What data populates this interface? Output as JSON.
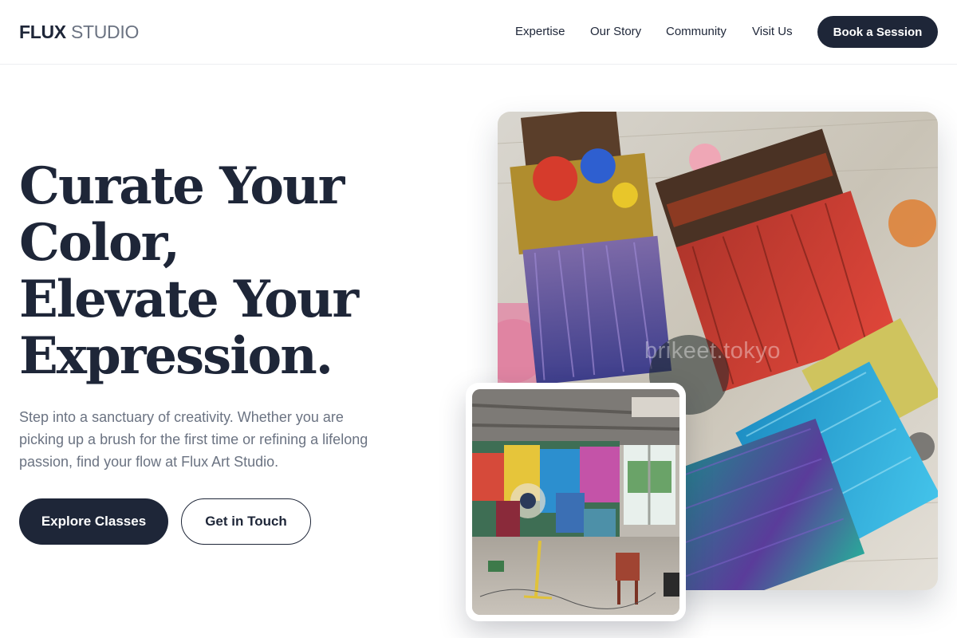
{
  "header": {
    "logo_bold": "FLUX",
    "logo_light": " STUDIO",
    "nav": [
      "Expertise",
      "Our Story",
      "Community",
      "Visit Us"
    ],
    "cta": "Book a Session"
  },
  "hero": {
    "headline_lines": [
      "Curate Your",
      "Color,",
      "Elevate Your",
      "Expression."
    ],
    "subtext": "Step into a sanctuary of creativity. Whether you are picking up a brush for the first time or refining a lifelong passion, find your flow at Flux Art Studio.",
    "primary_button": "Explore Classes",
    "secondary_button": "Get in Touch"
  },
  "images": {
    "main_watermark": "brikeet.tokyo"
  },
  "colors": {
    "primary": "#1e2638",
    "muted_text": "#6b7382",
    "background": "#ffffff"
  }
}
